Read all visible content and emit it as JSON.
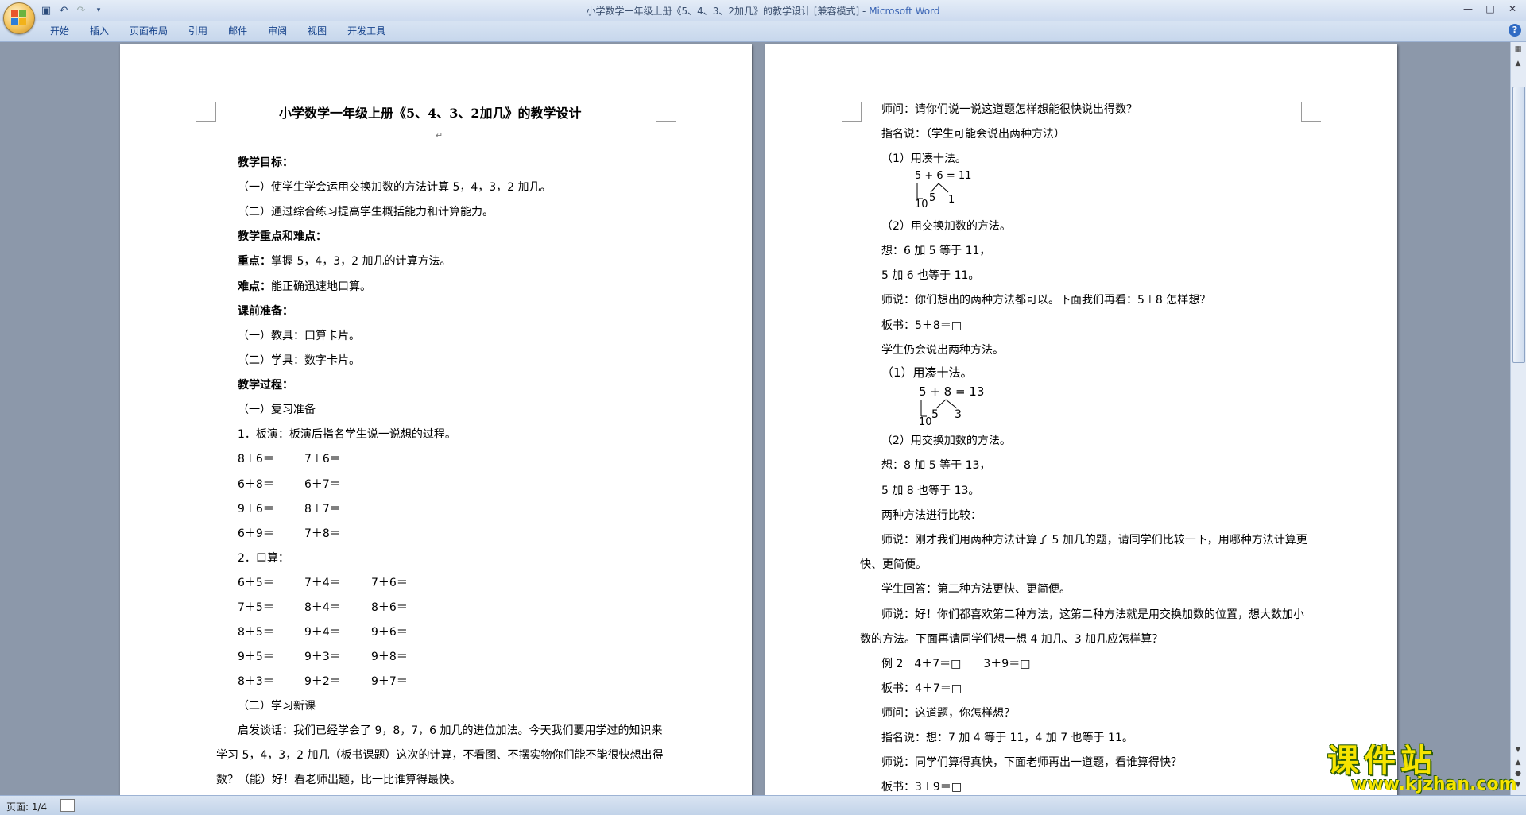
{
  "window": {
    "title_doc": "小学数学一年级上册《5、4、3、2加几》的教学设计 [兼容模式] - ",
    "title_app": "Microsoft Word"
  },
  "ribbon": {
    "tabs": [
      "开始",
      "插入",
      "页面布局",
      "引用",
      "邮件",
      "审阅",
      "视图",
      "开发工具"
    ]
  },
  "status": {
    "page": "页面: 1/4"
  },
  "watermark": {
    "cn": "课件站",
    "url": "www.kjzhan.com"
  },
  "page1": {
    "title": "小学数学一年级上册《5、4、3、2加几》的教学设计",
    "lines": [
      {
        "t": "教学目标：",
        "b": true
      },
      {
        "t": "（一）使学生学会运用交换加数的方法计算 5，4，3，2 加几。"
      },
      {
        "t": "（二）通过综合练习提高学生概括能力和计算能力。"
      },
      {
        "t": "教学重点和难点：",
        "b": true
      },
      {
        "t": "重点：",
        "b": true,
        "rest": "掌握 5，4，3，2 加几的计算方法。"
      },
      {
        "t": "难点：",
        "b": true,
        "rest": "能正确迅速地口算。"
      },
      {
        "t": "课前准备：",
        "b": true
      },
      {
        "t": "（一）教具：口算卡片。"
      },
      {
        "t": "（二）学具：数字卡片。"
      },
      {
        "t": "教学过程：",
        "b": true
      },
      {
        "t": "（一）复习准备"
      },
      {
        "t": "1．板演：板演后指名学生说一说想的过程。"
      }
    ],
    "drill1": [
      [
        "8＋6＝",
        "7＋6＝"
      ],
      [
        "6＋8＝",
        "6＋7＝"
      ],
      [
        "9＋6＝",
        "8＋7＝"
      ],
      [
        "6＋9＝",
        "7＋8＝"
      ]
    ],
    "oral_label": "2．口算：",
    "drill2": [
      [
        "6＋5＝",
        "7＋4＝",
        "7＋6＝"
      ],
      [
        "7＋5＝",
        "8＋4＝",
        "8＋6＝"
      ],
      [
        "8＋5＝",
        "9＋4＝",
        "9＋6＝"
      ],
      [
        "9＋5＝",
        "9＋3＝",
        "9＋8＝"
      ],
      [
        "8＋3＝",
        "9＋2＝",
        "9＋7＝"
      ]
    ],
    "new_lesson": "（二）学习新课",
    "para1": "启发谈话：我们已经学会了 9，8，7，6 加几的进位加法。今天我们要用学过的知识来",
    "para2": "学习 5，4，3，2 加几（板书课题）这次的计算，不看图、不摆实物你们能不能很快想出得",
    "para3": "数？（能）好！看老师出题，比一比谁算得最快。"
  },
  "page2": {
    "lines_a": [
      "师问：请你们说一说这道题怎样想能很快说出得数？",
      "指名说：（学生可能会说出两种方法）",
      "（1）用凑十法。"
    ],
    "diag1": {
      "eq": "5 + 6 = 11",
      "ten": "10",
      "a": "5",
      "b": "1"
    },
    "lines_b": [
      "（2）用交换加数的方法。",
      "想：6 加 5 等于 11，",
      "5 加 6 也等于 11。",
      "师说：你们想出的两种方法都可以。下面我们再看：5＋8 怎样想？",
      "板书：5＋8＝□",
      "学生仍会说出两种方法。"
    ],
    "method1b": "（1）用凑十法。",
    "diag2": {
      "eq": "5 + 8 = 13",
      "ten": "10",
      "a": "5",
      "b": "3"
    },
    "lines_c": [
      "（2）用交换加数的方法。",
      "想：8 加 5 等于 13，",
      "5 加 8 也等于 13。",
      "两种方法进行比较："
    ],
    "para_a1": "师说：刚才我们用两种方法计算了 5 加几的题，请同学们比较一下，用哪种方法计算更",
    "para_a2": "快、更简便。",
    "answer": "学生回答：第二种方法更快、更简便。",
    "para_b1": "师说：好！你们都喜欢第二种方法，这第二种方法就是用交换加数的位置，想大数加小",
    "para_b2": "数的方法。下面再请同学们想一想 4 加几、3 加几应怎样算？",
    "lines_d": [
      "例 2　4＋7＝□　　3＋9＝□",
      "板书：4＋7＝□",
      "师问：这道题，你怎样想？",
      "指名说：想：7 加 4 等于 11，4 加 7 也等于 11。",
      "师说：同学们算得真快，下面老师再出一道题，看谁算得快？",
      "板书：3＋9＝□"
    ]
  }
}
